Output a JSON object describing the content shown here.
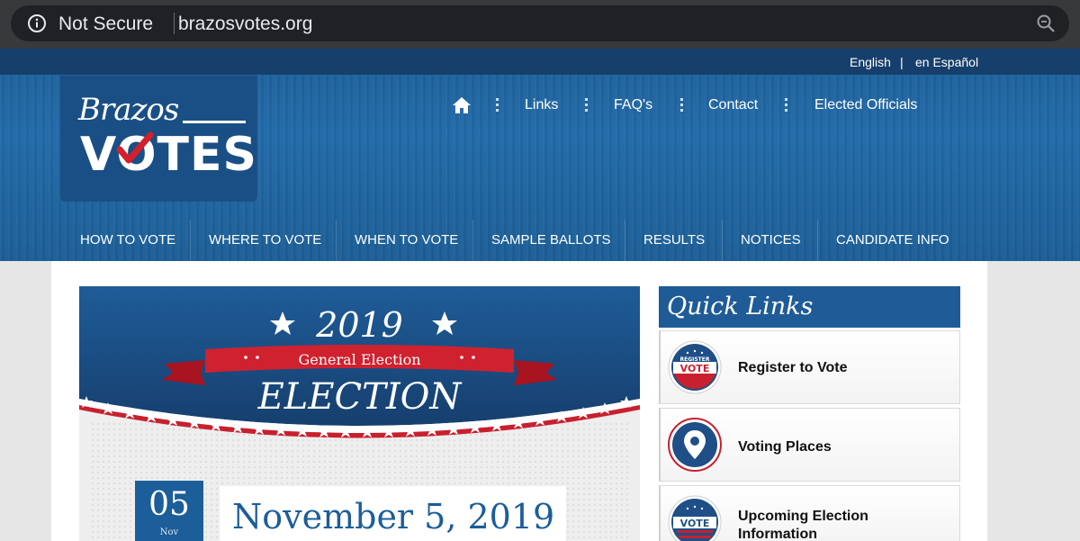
{
  "browser": {
    "security_label": "Not Secure",
    "url": "brazosvotes.org"
  },
  "language": {
    "english": "English",
    "separator": "|",
    "spanish": "en Español"
  },
  "logo": {
    "line1": "Brazos",
    "line2": "VOTES"
  },
  "top_nav": {
    "links": [
      "Links",
      "FAQ's",
      "Contact",
      "Elected Officials"
    ]
  },
  "main_nav": {
    "items": [
      "HOW TO VOTE",
      "WHERE TO VOTE",
      "WHEN TO VOTE",
      "SAMPLE BALLOTS",
      "RESULTS",
      "NOTICES",
      "CANDIDATE INFO"
    ]
  },
  "banner": {
    "year": "2019",
    "ribbon": "General Election",
    "heading": "ELECTION",
    "day": "05",
    "month": "Nov",
    "full_date": "November 5, 2019"
  },
  "quick_links": {
    "title": "Quick Links",
    "items": [
      {
        "label": "Register to Vote",
        "icon": "register-to-vote-badge-icon"
      },
      {
        "label": "Voting Places",
        "icon": "map-pin-icon"
      },
      {
        "label": "Upcoming Election Information",
        "icon": "vote-badge-icon"
      }
    ]
  },
  "colors": {
    "brand_blue": "#1f5b97",
    "accent_red": "#c8202e",
    "lang_bar": "#173f6b"
  }
}
